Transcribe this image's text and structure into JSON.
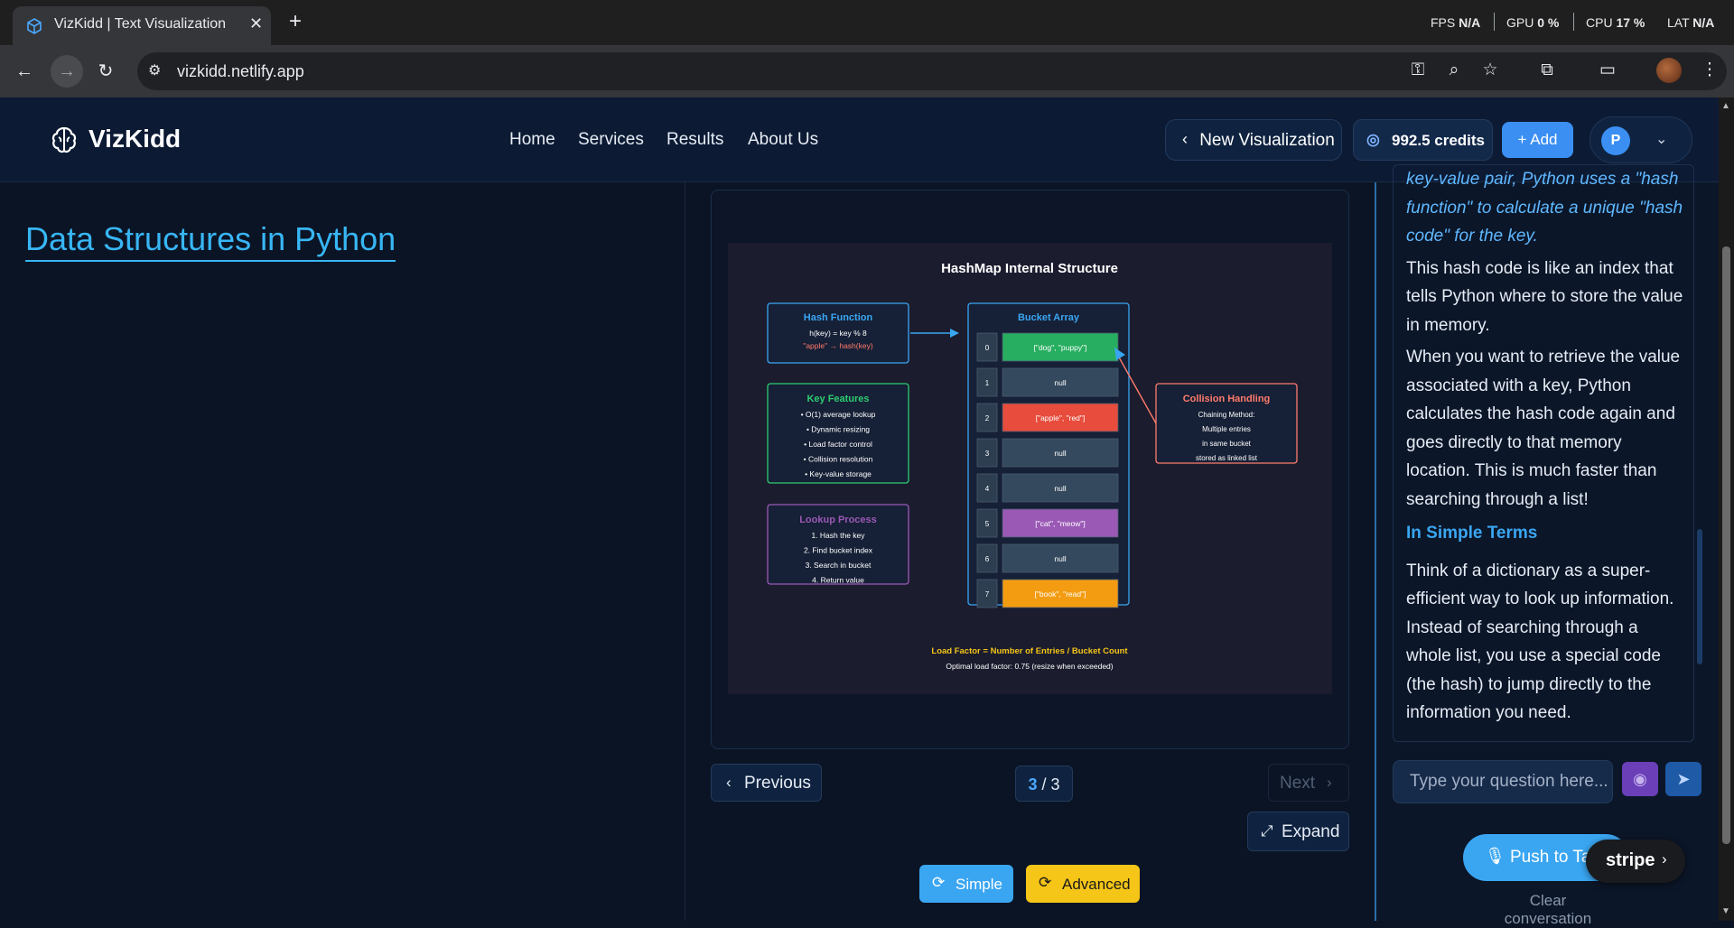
{
  "browser": {
    "tab_title": "VizKidd | Text Visualization",
    "url": "vizkidd.netlify.app",
    "perf": {
      "fps_label": "FPS",
      "fps_value": "N/A",
      "gpu_label": "GPU",
      "gpu_value": "0 %",
      "cpu_label": "CPU",
      "cpu_value": "17 %",
      "lat_label": "LAT",
      "lat_value": "N/A"
    }
  },
  "header": {
    "logo": "VizKidd",
    "nav": [
      "Home",
      "Services",
      "Results",
      "About Us"
    ],
    "new_visualization": "New Visualization",
    "credits": "992.5 credits",
    "add": "Add",
    "user_initial": "P"
  },
  "main": {
    "page_title": "Data Structures in Python",
    "pager_current": "3",
    "pager_sep": " / ",
    "pager_total": "3",
    "prev": "Previous",
    "next": "Next",
    "expand": "Expand",
    "simple": "Simple",
    "advanced": "Advanced"
  },
  "diagram": {
    "title": "HashMap Internal Structure",
    "hash_function": {
      "title": "Hash Function",
      "line1": "h(key) = key % 8",
      "line2": "\"apple\" → hash(key)"
    },
    "key_features": {
      "title": "Key Features",
      "items": [
        "• O(1) average lookup",
        "• Dynamic resizing",
        "• Load factor control",
        "• Collision resolution",
        "• Key-value storage"
      ]
    },
    "lookup_process": {
      "title": "Lookup Process",
      "items": [
        "1. Hash the key",
        "2. Find bucket index",
        "3. Search in bucket",
        "4. Return value"
      ]
    },
    "bucket_array": {
      "title": "Bucket Array",
      "buckets": [
        {
          "index": "0",
          "value": "[\"dog\", \"puppy\"]",
          "color": "#27ae60"
        },
        {
          "index": "1",
          "value": "null",
          "color": "#34495e"
        },
        {
          "index": "2",
          "value": "[\"apple\", \"red\"]",
          "color": "#e74c3c"
        },
        {
          "index": "3",
          "value": "null",
          "color": "#34495e"
        },
        {
          "index": "4",
          "value": "null",
          "color": "#34495e"
        },
        {
          "index": "5",
          "value": "[\"cat\", \"meow\"]",
          "color": "#9b59b6"
        },
        {
          "index": "6",
          "value": "null",
          "color": "#34495e"
        },
        {
          "index": "7",
          "value": "[\"book\", \"read\"]",
          "color": "#f39c12"
        }
      ]
    },
    "collision": {
      "title": "Collision Handling",
      "items": [
        "Chaining Method:",
        "Multiple entries",
        "in same bucket",
        "stored as linked list"
      ]
    },
    "load_factor": "Load Factor = Number of Entries / Bucket Count",
    "optimal": "Optimal load factor: 0.75 (resize when exceeded)"
  },
  "chat": {
    "partial_italic_1": "key-value pair, Python uses a \"hash",
    "partial_italic_2": "function\" to calculate a unique \"hash code\" for the key.",
    "p1": "This hash code is like an index that tells Python where to store the value in memory.",
    "p2": "When you want to retrieve the value associated with a key, Python calculates the hash code again and goes directly to that memory location. This is much faster than searching through a list!",
    "heading": "In Simple Terms",
    "p3": "Think of a dictionary as a super-efficient way to look up information. Instead of searching through a whole list, you use a special code (the hash) to jump directly to the information you need.",
    "input_placeholder": "Type your question here...",
    "push_to_talk": "Push to Talk",
    "stripe": "stripe",
    "clear": "Clear conversation"
  }
}
